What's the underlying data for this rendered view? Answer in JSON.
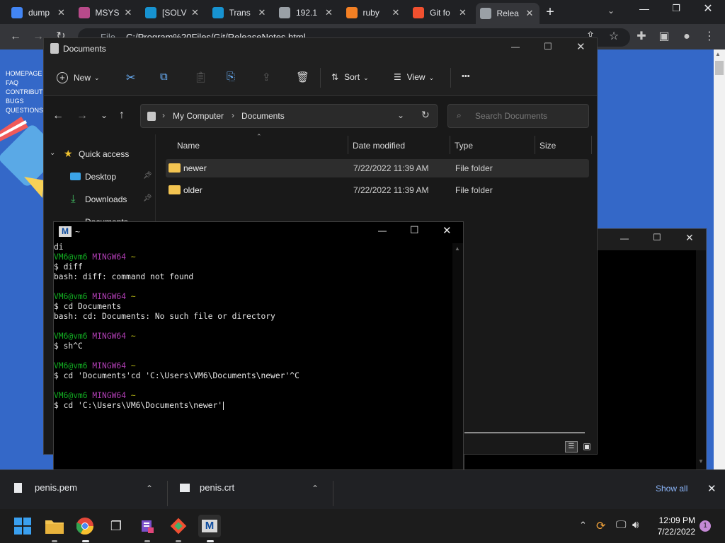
{
  "browser": {
    "tabs": [
      {
        "label": "dump",
        "favicon": "google-icon",
        "favicon_color": "#4285f4",
        "active": false
      },
      {
        "label": "MSYS",
        "favicon": "msys-icon",
        "favicon_color": "#b84a8a",
        "active": false
      },
      {
        "label": "[SOLV",
        "favicon": "arch-icon",
        "favicon_color": "#1793d1",
        "active": false
      },
      {
        "label": "Trans",
        "favicon": "arch-icon",
        "favicon_color": "#1793d1",
        "active": false
      },
      {
        "label": "192.1",
        "favicon": "globe-icon",
        "favicon_color": "#9aa0a6",
        "active": false
      },
      {
        "label": "ruby",
        "favicon": "stackoverflow-icon",
        "favicon_color": "#f48024",
        "active": false
      },
      {
        "label": "Git fo",
        "favicon": "git-icon",
        "favicon_color": "#f1502f",
        "active": false
      },
      {
        "label": "Relea",
        "favicon": "globe-icon",
        "favicon_color": "#9aa0a6",
        "active": true
      }
    ],
    "new_tab": "+",
    "address_prefix": "File",
    "address": "C:/Program%20Files/Git/ReleaseNotes.html"
  },
  "webpage": {
    "nav": [
      "HOMEPAGE",
      "FAQ",
      "CONTRIBUT",
      "BUGS",
      "QUESTIONS"
    ],
    "background": "#3468c8"
  },
  "explorer": {
    "title": "Documents",
    "toolbar": {
      "new_label": "New",
      "sort_label": "Sort",
      "view_label": "View",
      "more_label": "•••"
    },
    "breadcrumb": [
      "My Computer",
      "Documents"
    ],
    "search_placeholder": "Search Documents",
    "sidebar": [
      {
        "label": "Quick access"
      },
      {
        "label": "Desktop"
      },
      {
        "label": "Downloads"
      },
      {
        "label": "Documents"
      }
    ],
    "columns": [
      "Name",
      "Date modified",
      "Type",
      "Size"
    ],
    "rows": [
      {
        "name": "newer",
        "date": "7/22/2022 11:39 AM",
        "type": "File folder",
        "size": ""
      },
      {
        "name": "older",
        "date": "7/22/2022 11:39 AM",
        "type": "File folder",
        "size": ""
      }
    ]
  },
  "terminal": {
    "title": "~",
    "lines": [
      [
        {
          "t": "di",
          "c": ""
        }
      ],
      [
        {
          "t": "VM6@vm6 ",
          "c": "green"
        },
        {
          "t": "MINGW64",
          "c": "purple"
        },
        {
          "t": " ~",
          "c": "yellow"
        }
      ],
      [
        {
          "t": "$ diff",
          "c": ""
        }
      ],
      [
        {
          "t": "bash: diff: command not found",
          "c": ""
        }
      ],
      [
        {
          "t": "",
          "c": ""
        }
      ],
      [
        {
          "t": "VM6@vm6 ",
          "c": "green"
        },
        {
          "t": "MINGW64",
          "c": "purple"
        },
        {
          "t": " ~",
          "c": "yellow"
        }
      ],
      [
        {
          "t": "$ cd Documents",
          "c": ""
        }
      ],
      [
        {
          "t": "bash: cd: Documents: No such file or directory",
          "c": ""
        }
      ],
      [
        {
          "t": "",
          "c": ""
        }
      ],
      [
        {
          "t": "VM6@vm6 ",
          "c": "green"
        },
        {
          "t": "MINGW64",
          "c": "purple"
        },
        {
          "t": " ~",
          "c": "yellow"
        }
      ],
      [
        {
          "t": "$ sh^C",
          "c": ""
        }
      ],
      [
        {
          "t": "",
          "c": ""
        }
      ],
      [
        {
          "t": "VM6@vm6 ",
          "c": "green"
        },
        {
          "t": "MINGW64",
          "c": "purple"
        },
        {
          "t": " ~",
          "c": "yellow"
        }
      ],
      [
        {
          "t": "$ cd 'Documents'cd 'C:\\Users\\VM6\\Documents\\newer'^C",
          "c": ""
        }
      ],
      [
        {
          "t": "",
          "c": ""
        }
      ],
      [
        {
          "t": "VM6@vm6 ",
          "c": "green"
        },
        {
          "t": "MINGW64",
          "c": "purple"
        },
        {
          "t": " ~",
          "c": "yellow"
        }
      ],
      [
        {
          "t": "$ cd 'C:\\Users\\VM6\\Documents\\newer'",
          "c": ""
        }
      ]
    ]
  },
  "downloads": [
    {
      "name": "penis.pem"
    },
    {
      "name": "penis.crt"
    }
  ],
  "downloads_show_all": "Show all",
  "taskbar": {
    "time": "12:09 PM",
    "date": "7/22/2022",
    "notification_count": "1"
  }
}
